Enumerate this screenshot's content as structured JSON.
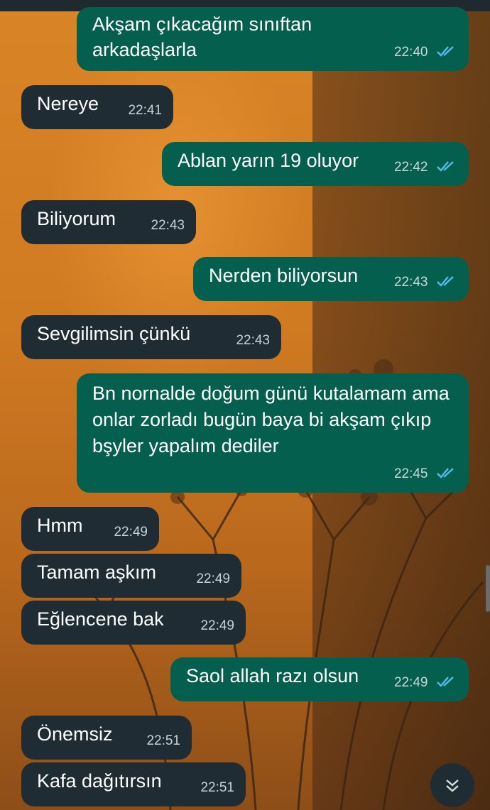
{
  "messages": [
    {
      "direction": "out",
      "text": "Akşam çıkacağım sınıftan arkadaşlarla",
      "time": "22:40",
      "ticks": "double-check-icon"
    },
    {
      "direction": "in",
      "text": "Nereye",
      "time": "22:41"
    },
    {
      "direction": "out",
      "text": "Ablan yarın 19 oluyor",
      "time": "22:42",
      "ticks": "double-check-icon"
    },
    {
      "direction": "in",
      "text": "Biliyorum",
      "time": "22:43"
    },
    {
      "direction": "out",
      "text": "Nerden biliyorsun",
      "time": "22:43",
      "ticks": "double-check-icon"
    },
    {
      "direction": "in",
      "text": "Sevgilimsin çünkü",
      "time": "22:43"
    },
    {
      "direction": "out",
      "text": "Bn nornalde doğum günü kutalamam ama onlar zorladı bugün baya bi akşam çıkıp bşyler yapalım dediler",
      "time": "22:45",
      "ticks": "double-check-icon"
    },
    {
      "direction": "in",
      "text": "Hmm",
      "time": "22:49"
    },
    {
      "direction": "in",
      "text": "Tamam aşkım",
      "time": "22:49"
    },
    {
      "direction": "in",
      "text": "Eğlencene bak",
      "time": "22:49"
    },
    {
      "direction": "out",
      "text": "Saol allah razı olsun",
      "time": "22:49",
      "ticks": "double-check-icon"
    },
    {
      "direction": "in",
      "text": "Önemsiz",
      "time": "22:51"
    },
    {
      "direction": "in",
      "text": "Kafa dağıtırsın",
      "time": "22:51"
    }
  ],
  "scroll_button": {
    "icon": "double-chevron-down-icon"
  },
  "colors": {
    "incoming_bubble": "#1f2c34",
    "outgoing_bubble": "#045f4e",
    "read_ticks": "#53bdeb",
    "wallpaper": "#d07a22"
  }
}
